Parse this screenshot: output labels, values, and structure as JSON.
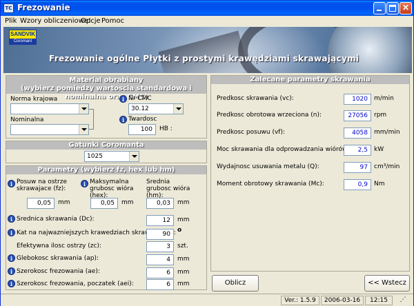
{
  "window": {
    "title": "Frezowanie",
    "icon": "app-icon"
  },
  "menu": [
    "Plik",
    "Wzory obliczeniowe!",
    "Opcje",
    "Pomoc"
  ],
  "banner": {
    "logo_top": "SANDVIK",
    "logo_bottom": "Coromant",
    "title": "Frezowanie ogólne Płytki z prostymi krawędziami skrawającymi"
  },
  "material": {
    "heading_line1": "Material obrabiany",
    "heading_line2": "(wybierz pomiedzy wartoscia standardowa i nominalna oraz CMC)",
    "norma_label": "Norma krajowa",
    "norma_value": "",
    "nominalna_label": "Nominalna",
    "nominalna_value": "",
    "cmc_label": "Nr CMC",
    "cmc_value": "30.12",
    "twardosc_label": "Twardosc",
    "twardosc_value": "100",
    "twardosc_unit": "HB :"
  },
  "grades": {
    "heading": "Gatunki Coromanta",
    "value": "1025"
  },
  "params": {
    "heading": "Parametry (wybierz fz, hex lub hm)",
    "fz_label": "Posuw na ostrze skrawajace (fz):",
    "fz_value": "0,05",
    "fz_unit": "mm",
    "hex_label": "Maksymalna grubosc wióra (hex):",
    "hex_value": "0,05",
    "hex_unit": "mm",
    "hm_label": "Srednia grubosc wióra (hm):",
    "hm_value": "0,03",
    "hm_unit": "mm",
    "rows": [
      {
        "label": "Srednica skrawania (Dc):",
        "value": "12",
        "unit": "mm",
        "info": true
      },
      {
        "label": "Kat na najwazniejszych krawedziach skrawajacych:",
        "value": "90",
        "unit": "o",
        "info": true
      },
      {
        "label": "Efektywna ilosc ostrzy (zc):",
        "value": "3",
        "unit": "szt.",
        "info": false
      },
      {
        "label": "Glebokosc skrawania (ap):",
        "value": "4",
        "unit": "mm",
        "info": true
      },
      {
        "label": "Szerokosc frezowania (ae):",
        "value": "6",
        "unit": "mm",
        "info": true
      },
      {
        "label": "Szerokosc frezowania, poczatek (aei):",
        "value": "6",
        "unit": "mm",
        "info": true
      }
    ]
  },
  "results": {
    "heading": "Zalecane parametry skrawania",
    "rows": [
      {
        "label": "Predkosc skrawania (vc):",
        "value": "1020",
        "unit": "m/min"
      },
      {
        "label": "Predkosc obrotowa wrzeciona (n):",
        "value": "27056",
        "unit": "rpm"
      },
      {
        "label": "Predkosc posuwu (vf):",
        "value": "4058",
        "unit": "mm/min"
      },
      {
        "label": "Moc skrawania dla odprowadzania wiórów (Pc):",
        "value": "2,5",
        "unit": "kW"
      },
      {
        "label": "Wydajnosc usuwania metalu (Q):",
        "value": "97",
        "unit": "cm³/min"
      },
      {
        "label": "Moment obrotowy skrawania (Mc):",
        "value": "0,9",
        "unit": "Nm"
      }
    ]
  },
  "buttons": {
    "calc": "Oblicz",
    "back": "<< Wstecz"
  },
  "status": {
    "version": "Ver.: 1.5.9",
    "date": "2006-03-16",
    "time": "12:15"
  }
}
